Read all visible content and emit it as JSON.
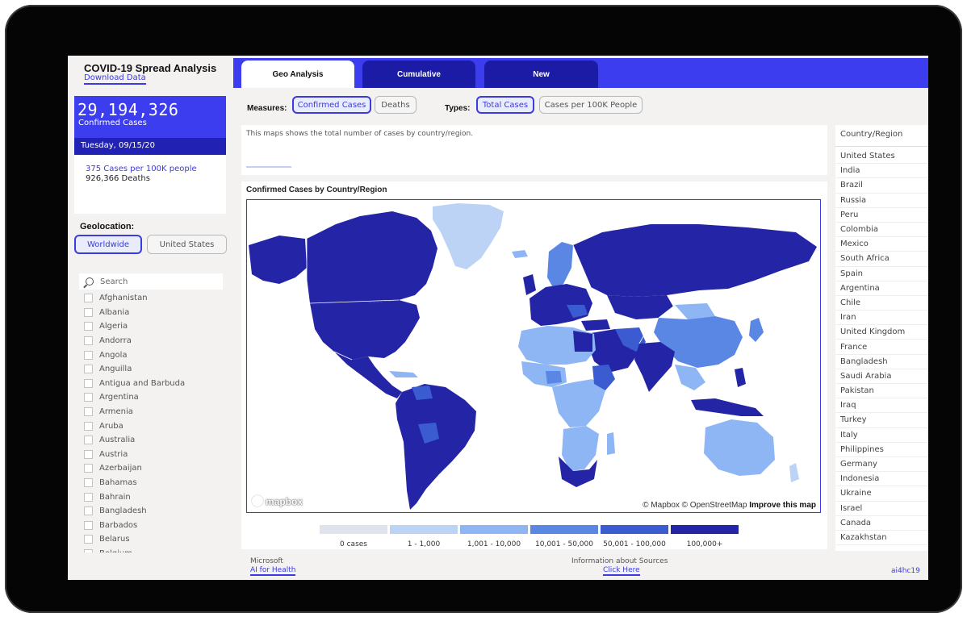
{
  "app": {
    "title": "COVID-19 Spread Analysis",
    "download_link": "Download Data"
  },
  "stats": {
    "confirmed_value": "29,194,326",
    "confirmed_label": "Confirmed Cases",
    "date": "Tuesday, 09/15/20",
    "cases_per_100k": "375 Cases per 100K people",
    "deaths": "926,366 Deaths"
  },
  "geolocation": {
    "label": "Geolocation:",
    "options": [
      "Worldwide",
      "United States"
    ],
    "selected": "Worldwide"
  },
  "search": {
    "placeholder": "Search"
  },
  "country_filter": [
    "Afghanistan",
    "Albania",
    "Algeria",
    "Andorra",
    "Angola",
    "Anguilla",
    "Antigua and Barbuda",
    "Argentina",
    "Armenia",
    "Aruba",
    "Australia",
    "Austria",
    "Azerbaijan",
    "Bahamas",
    "Bahrain",
    "Bangladesh",
    "Barbados",
    "Belarus",
    "Belgium"
  ],
  "tabs": [
    {
      "label": "Geo Analysis",
      "active": true
    },
    {
      "label": "Cumulative",
      "active": false
    },
    {
      "label": "New",
      "active": false
    }
  ],
  "measures": {
    "label": "Measures:",
    "options": [
      "Confirmed Cases",
      "Deaths"
    ],
    "selected": "Confirmed Cases"
  },
  "types": {
    "label": "Types:",
    "options": [
      "Total Cases",
      "Cases per 100K People"
    ],
    "selected": "Total Cases"
  },
  "description": "This maps shows the total number of cases by country/region.",
  "map": {
    "title": "Confirmed Cases by Country/Region",
    "logo_text": "mapbox",
    "attribution": "© Mapbox © OpenStreetMap",
    "improve_link": "Improve this map",
    "legend": [
      {
        "label": "0 cases",
        "color": "#dfe3ec"
      },
      {
        "label": "1 - 1,000",
        "color": "#bcd3f6"
      },
      {
        "label": "1,001 - 10,000",
        "color": "#8fb6f4"
      },
      {
        "label": "10,001 - 50,000",
        "color": "#5a86e4"
      },
      {
        "label": "50,001 - 100,000",
        "color": "#3a5cd0"
      },
      {
        "label": "100,000+",
        "color": "#2424a6"
      }
    ]
  },
  "country_table": {
    "header": "Country/Region",
    "rows": [
      "United States",
      "India",
      "Brazil",
      "Russia",
      "Peru",
      "Colombia",
      "Mexico",
      "South Africa",
      "Spain",
      "Argentina",
      "Chile",
      "Iran",
      "United Kingdom",
      "France",
      "Bangladesh",
      "Saudi Arabia",
      "Pakistan",
      "Iraq",
      "Turkey",
      "Italy",
      "Philippines",
      "Germany",
      "Indonesia",
      "Ukraine",
      "Israel",
      "Canada",
      "Kazakhstan"
    ]
  },
  "footer": {
    "org": "Microsoft",
    "program": "AI for Health",
    "sources_label": "Information about Sources",
    "sources_link": "Click Here",
    "right_link": "ai4hc19"
  },
  "colors": {
    "accent": "#3d3df0",
    "accent_dark": "#1b1ba5",
    "date_bar": "#2121b4"
  }
}
